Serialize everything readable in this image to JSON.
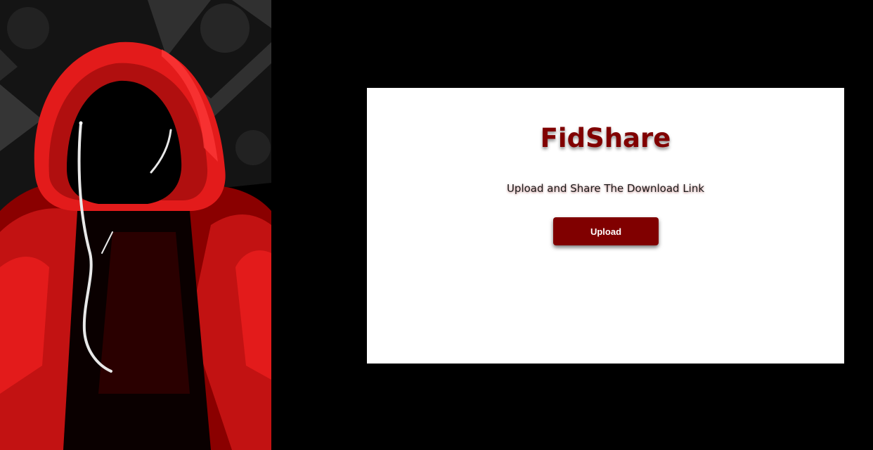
{
  "hero": {
    "illustration": "red-hooded-figure-with-earphones",
    "colors": {
      "hood": "#e31b1b",
      "hood_dark": "#8a0000",
      "background": "#000000",
      "wire": "#e8e8e8"
    }
  },
  "card": {
    "title": "FidShare",
    "subtitle": "Upload and Share The Download Link",
    "upload_label": "Upload"
  },
  "colors": {
    "brand": "#800000",
    "page_background": "#000000",
    "card_background": "#ffffff"
  }
}
